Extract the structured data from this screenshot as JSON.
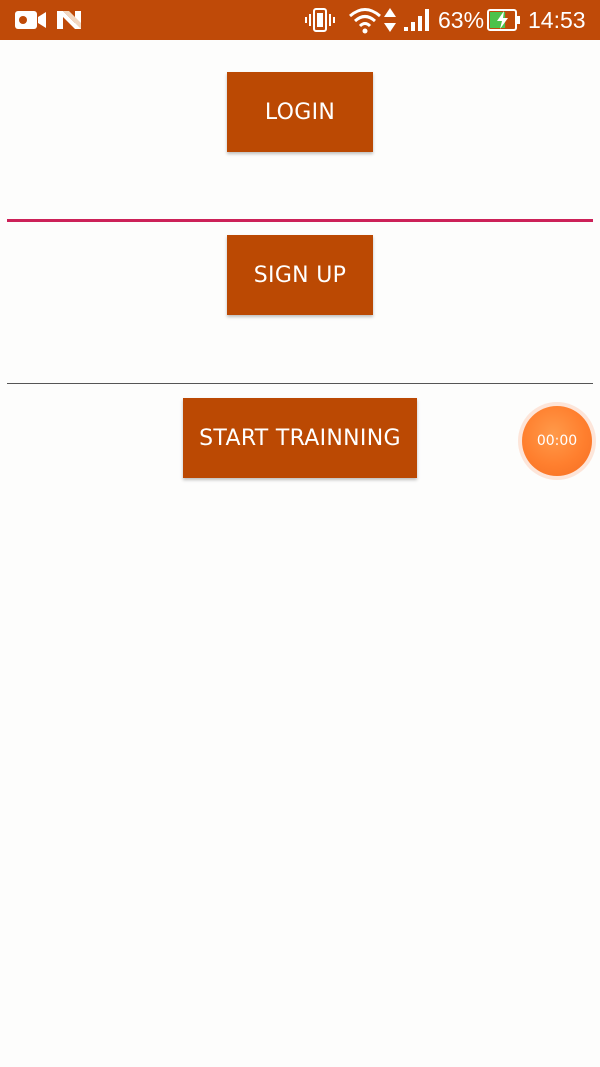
{
  "status_bar": {
    "icons_left": [
      "video-camera-icon",
      "n-notification-icon"
    ],
    "icons_right": [
      "vibrate-icon",
      "wifi-icon",
      "data-arrows-icon",
      "signal-icon"
    ],
    "battery_percent": "63%",
    "battery_level": 0.63,
    "time": "14:53",
    "background_color": "#bf4a08"
  },
  "buttons": {
    "login_label": "LOGIN",
    "signup_label": "SIGN UP",
    "start_training_label": "START TRAINNING",
    "color": "#bb4903"
  },
  "dividers": {
    "first_color": "#cc2158",
    "second_color": "#555555"
  },
  "timer": {
    "label": "00:00",
    "color": "#ff7f2e"
  }
}
